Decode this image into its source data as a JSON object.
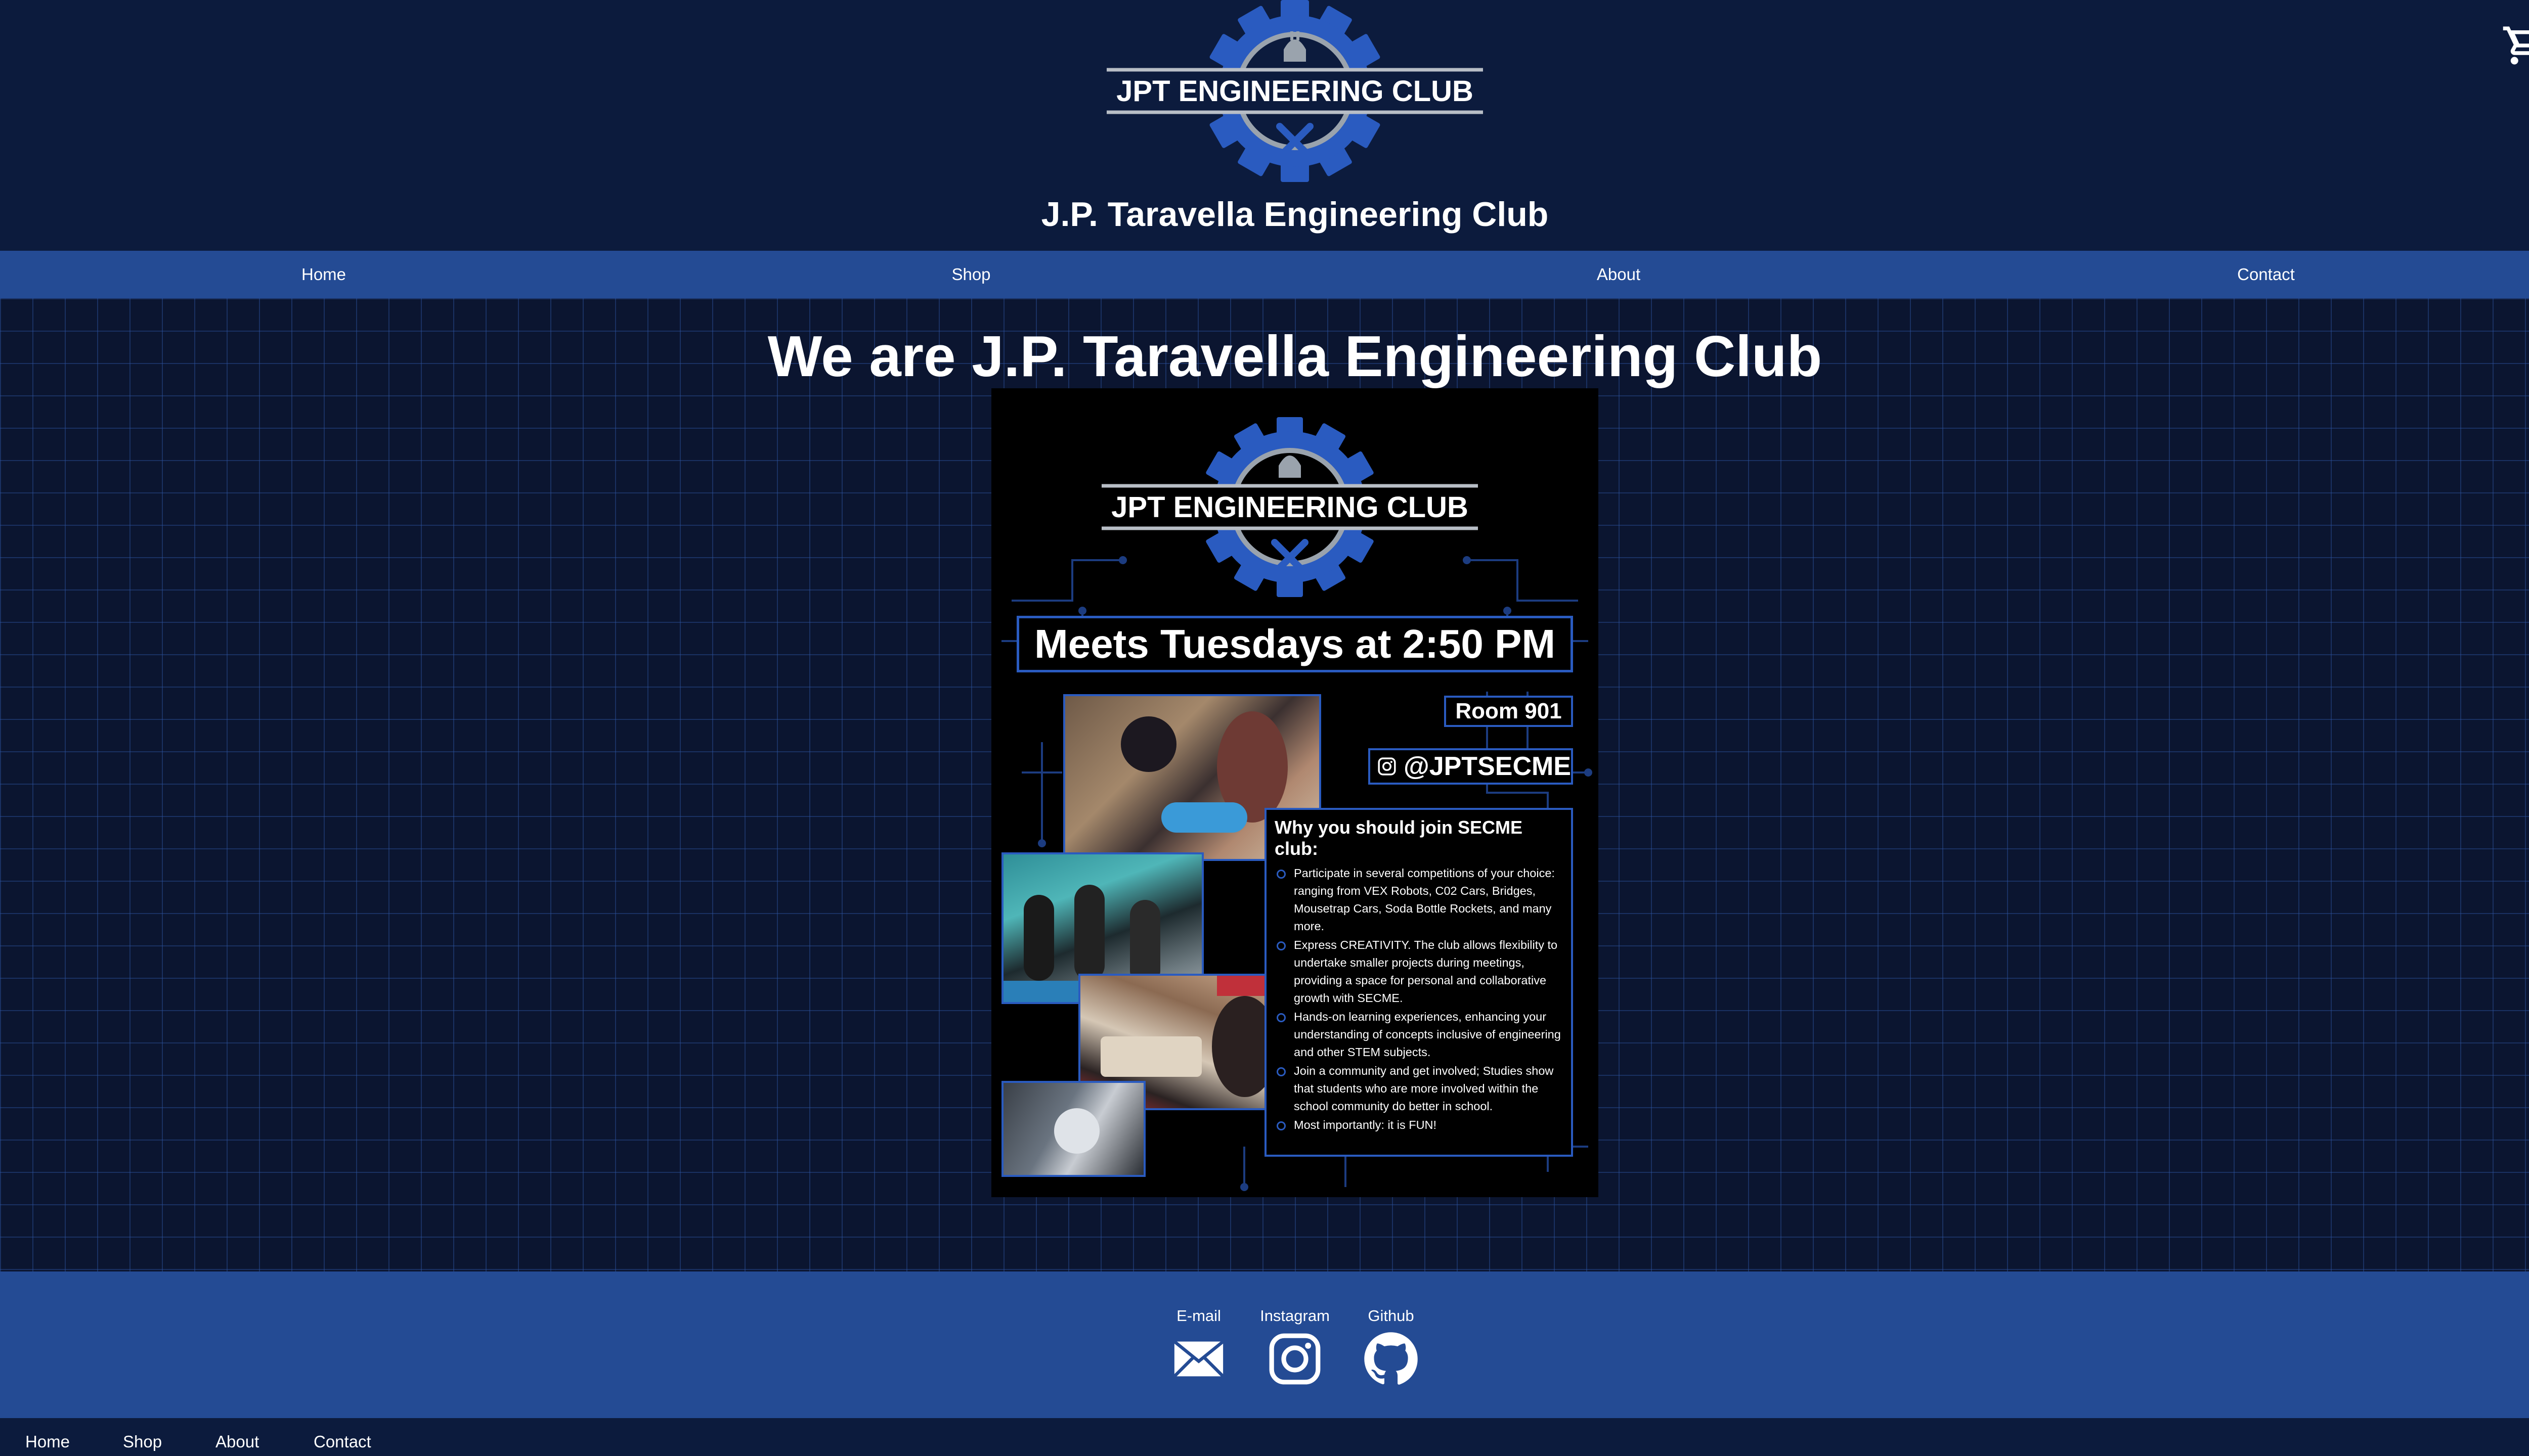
{
  "header": {
    "logo_text": "JPT ENGINEERING CLUB",
    "site_title": "J.P. Taravella Engineering Club",
    "cart_icon": "cart-icon"
  },
  "nav": {
    "items": [
      {
        "label": "Home"
      },
      {
        "label": "Shop"
      },
      {
        "label": "About"
      },
      {
        "label": "Contact"
      }
    ]
  },
  "main": {
    "heading": "We are J.P. Taravella Engineering Club"
  },
  "flyer": {
    "logo_text": "JPT ENGINEERING CLUB",
    "meeting": "Meets Tuesdays at 2:50 PM",
    "room": "Room 901",
    "instagram_handle": "@JPTSECME",
    "why_title": "Why you should join SECME club:",
    "why_items": [
      "Participate in several competitions of your choice: ranging from VEX Robots, C02 Cars, Bridges, Mousetrap Cars, Soda Bottle Rockets, and many more.",
      "Express CREATIVITY. The club allows flexibility to undertake smaller projects during meetings, providing a space for personal and collaborative growth with SECME.",
      "Hands-on learning experiences, enhancing your understanding of concepts inclusive of engineering and other STEM subjects.",
      "Join a community and get involved; Studies show that students who are more involved within the school community do better in school.",
      "Most importantly: it is FUN!"
    ]
  },
  "footer": {
    "social": [
      {
        "label": "E-mail",
        "icon": "email-icon"
      },
      {
        "label": "Instagram",
        "icon": "instagram-icon"
      },
      {
        "label": "Github",
        "icon": "github-icon"
      }
    ],
    "bottom_links": [
      {
        "label": "Home"
      },
      {
        "label": "Shop"
      },
      {
        "label": "About"
      },
      {
        "label": "Contact"
      }
    ]
  },
  "colors": {
    "header_bg": "#0c1b3d",
    "nav_bg": "#244b94",
    "accent_blue": "#2a5bc0",
    "page_bg": "#0b1530"
  }
}
